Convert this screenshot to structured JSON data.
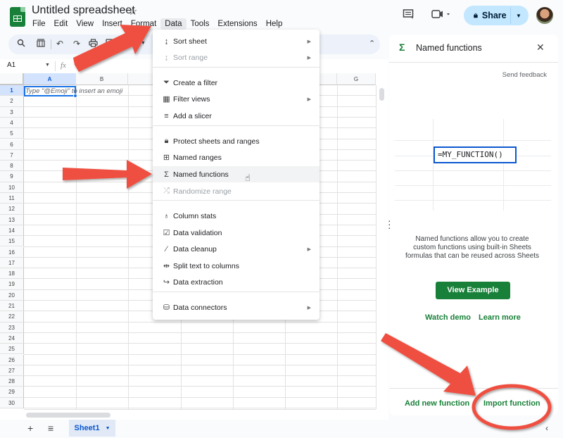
{
  "header": {
    "doc_title": "Untitled spreadsheet",
    "menus": [
      "File",
      "Edit",
      "View",
      "Insert",
      "Format",
      "Data",
      "Tools",
      "Extensions",
      "Help"
    ],
    "active_menu": "Data",
    "share_label": "Share"
  },
  "formula_bar": {
    "name_box": "A1",
    "fx": "fx"
  },
  "grid": {
    "columns": [
      "A",
      "B",
      "",
      "",
      "",
      "",
      "G"
    ],
    "rows": [
      "1",
      "2",
      "3",
      "4",
      "5",
      "6",
      "7",
      "8",
      "9",
      "10",
      "11",
      "12",
      "13",
      "14",
      "15",
      "16",
      "17",
      "18",
      "19",
      "20",
      "21",
      "22",
      "23",
      "24",
      "25",
      "26",
      "27",
      "28",
      "29",
      "30"
    ],
    "selected_cell": "A1",
    "cell_hint": "Type \"@Emoji\" to insert an emoji"
  },
  "data_menu": {
    "items": [
      {
        "label": "Sort sheet",
        "icon": "sort-icon",
        "submenu": true,
        "disabled": false
      },
      {
        "label": "Sort range",
        "icon": "sort-icon",
        "submenu": true,
        "disabled": true
      },
      {
        "label": "Create a filter",
        "icon": "filter-icon",
        "submenu": false,
        "disabled": false
      },
      {
        "label": "Filter views",
        "icon": "filter-views-icon",
        "submenu": true,
        "disabled": false
      },
      {
        "label": "Add a slicer",
        "icon": "slicer-icon",
        "submenu": false,
        "disabled": false
      },
      {
        "label": "Protect sheets and ranges",
        "icon": "lock-icon",
        "submenu": false,
        "disabled": false
      },
      {
        "label": "Named ranges",
        "icon": "named-ranges-icon",
        "submenu": false,
        "disabled": false
      },
      {
        "label": "Named functions",
        "icon": "sigma-icon",
        "submenu": false,
        "disabled": false,
        "hovered": true
      },
      {
        "label": "Randomize range",
        "icon": "shuffle-icon",
        "submenu": false,
        "disabled": true
      },
      {
        "label": "Column stats",
        "icon": "lightbulb-icon",
        "submenu": false,
        "disabled": false
      },
      {
        "label": "Data validation",
        "icon": "data-validation-icon",
        "submenu": false,
        "disabled": false
      },
      {
        "label": "Data cleanup",
        "icon": "magic-wand-icon",
        "submenu": true,
        "disabled": false
      },
      {
        "label": "Split text to columns",
        "icon": "split-icon",
        "submenu": false,
        "disabled": false
      },
      {
        "label": "Data extraction",
        "icon": "extraction-icon",
        "submenu": false,
        "disabled": false
      },
      {
        "label": "Data connectors",
        "icon": "database-icon",
        "submenu": true,
        "disabled": false
      }
    ]
  },
  "side_panel": {
    "title": "Named functions",
    "send_feedback": "Send feedback",
    "formula_example": "=MY_FUNCTION()",
    "description": "Named functions allow you to create custom functions using built-in Sheets formulas that can be reused across Sheets",
    "view_example": "View Example",
    "watch_demo": "Watch demo",
    "learn_more": "Learn more",
    "add_new_function": "Add new function",
    "import_function": "Import function"
  },
  "sheet_bar": {
    "tab": "Sheet1"
  },
  "colors": {
    "accent_green": "#188038",
    "selection_blue": "#1a73e8",
    "share_bg": "#c2e7ff",
    "annotation_red": "#ef4f3f"
  }
}
